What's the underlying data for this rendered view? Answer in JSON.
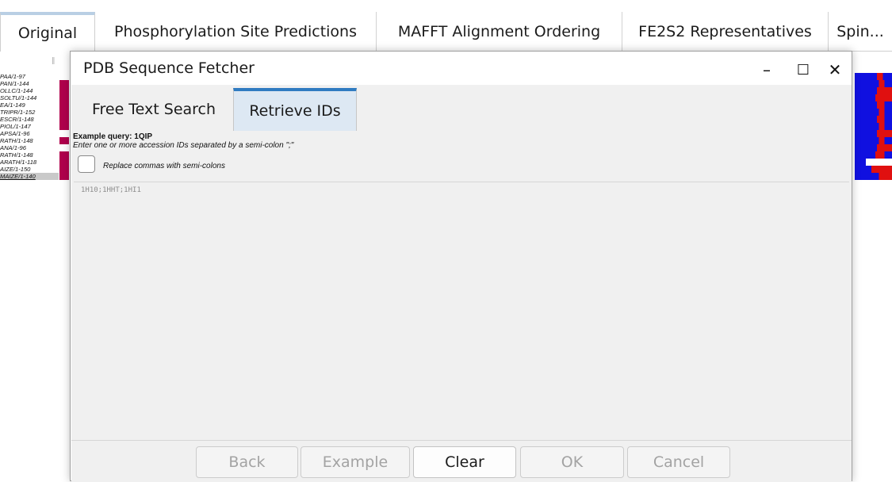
{
  "app_tabs": [
    {
      "label": "Original",
      "active": true
    },
    {
      "label": "Phosphorylation Site Predictions",
      "active": false
    },
    {
      "label": "MAFFT Alignment Ordering",
      "active": false
    },
    {
      "label": "FE2S2 Representatives",
      "active": false
    },
    {
      "label": "Spin...",
      "active": false
    }
  ],
  "sequences": [
    "PAA/1-97",
    "PAN/1-144",
    "OLLC/1-144",
    "SOLTU/1-144",
    "EA/1-149",
    "TRIPR/1-152",
    "ESCR/1-148",
    "PIOL/1-147",
    "APSA/1-96",
    "RATH/1-148",
    "ANA/1-96",
    "RATH/1-148",
    "ARATH/1-118",
    "AIZE/1-150",
    "MAIZE/1-140"
  ],
  "colors": {
    "hydrophobic": "#b0004c",
    "blue": "#0000ff",
    "red": "#ff0000",
    "tab_accent": "#2f7bc1",
    "active_tab_bg": "#dde8f3",
    "panel_bg": "#f0f0f0"
  },
  "dialog": {
    "title": "PDB Sequence Fetcher",
    "controls": {
      "minimize": "–",
      "maximize": "☐",
      "close": "✕"
    },
    "tabs": [
      {
        "label": "Free Text Search",
        "active": false
      },
      {
        "label": "Retrieve IDs",
        "active": true
      }
    ],
    "example_query": "Example query: 1QIP",
    "hint": "Enter one or more accession IDs separated by a semi-colon \";\"",
    "checkbox": {
      "label": "Replace commas with semi-colons",
      "checked": false
    },
    "input_text": "1H10;1HHT;1HI1",
    "buttons": [
      {
        "label": "Back",
        "enabled": false
      },
      {
        "label": "Example",
        "enabled": false
      },
      {
        "label": "Clear",
        "enabled": true
      },
      {
        "label": "OK",
        "enabled": false
      },
      {
        "label": "Cancel",
        "enabled": false
      }
    ]
  }
}
